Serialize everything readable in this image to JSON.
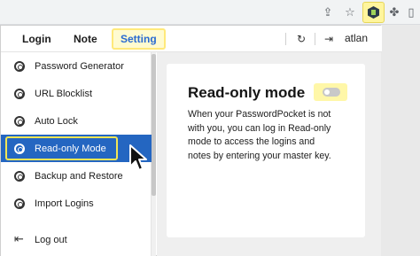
{
  "browser": {
    "toolbar_icons": [
      "share-icon",
      "star-icon",
      "extension-hex-icon",
      "puzzle-icon",
      "sidebar-icon"
    ]
  },
  "topnav": {
    "tabs": [
      {
        "label": "Login"
      },
      {
        "label": "Note"
      },
      {
        "label": "Setting",
        "active": true
      }
    ],
    "username": "atlan"
  },
  "sidebar": {
    "items": [
      {
        "label": "Password Generator",
        "icon": "gear-icon"
      },
      {
        "label": "URL Blocklist",
        "icon": "gear-icon"
      },
      {
        "label": "Auto Lock",
        "icon": "gear-icon"
      },
      {
        "label": "Read-only Mode",
        "icon": "gear-icon",
        "active": true
      },
      {
        "label": "Backup and Restore",
        "icon": "gear-icon"
      },
      {
        "label": "Import Logins",
        "icon": "gear-icon"
      },
      {
        "label": "Log out",
        "icon": "logout-icon"
      }
    ]
  },
  "panel": {
    "title": "Read-only mode",
    "toggle_on": false,
    "description": "When your PasswordPocket is not with you, you can log in Read-only mode to access the logins and notes by entering your master key."
  },
  "colors": {
    "accent": "#2466c1",
    "highlight": "#fff59d",
    "active_tab_text": "#2a6bd1"
  }
}
